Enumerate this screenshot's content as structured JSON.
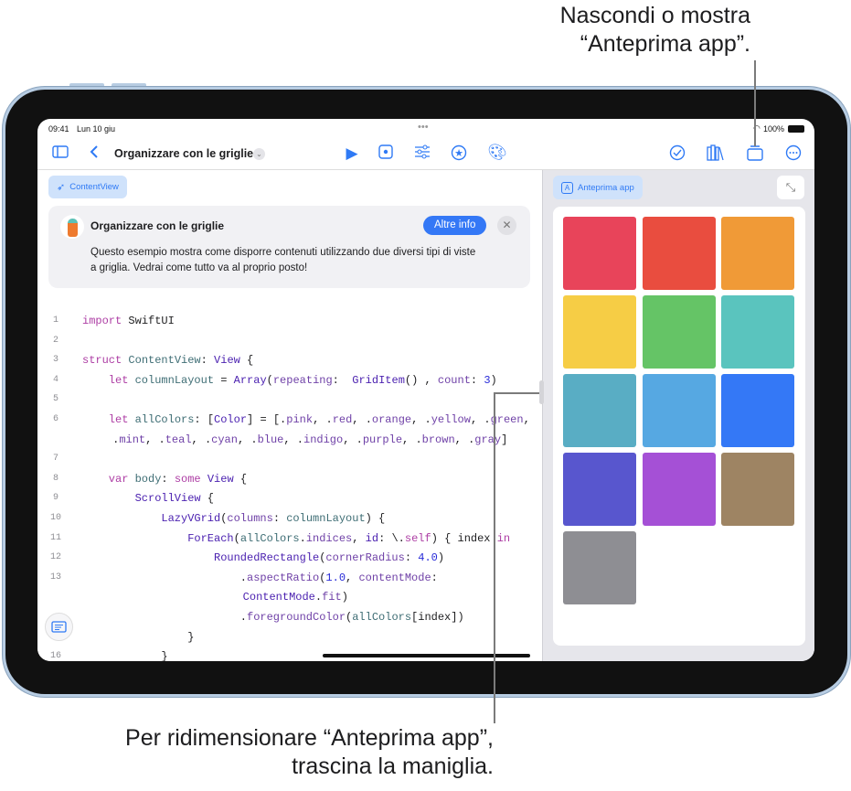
{
  "callouts": {
    "top_line1": "Nascondi o mostra",
    "top_line2": "“Anteprima app”.",
    "bottom_line1": "Per ridimensionare “Anteprima app”,",
    "bottom_line2": "trascina la maniglia."
  },
  "status": {
    "time": "09:41",
    "date": "Lun 10 giu",
    "battery": "100%"
  },
  "toolbar": {
    "title": "Organizzare con le griglie"
  },
  "file_tab": "ContentView",
  "card": {
    "title": "Organizzare con le griglie",
    "more_label": "Altre info",
    "text_line1": "Questo esempio mostra come disporre contenuti utilizzando due diversi tipi di viste",
    "text_line2": "a griglia. Vedrai come tutto va al proprio posto!"
  },
  "code": [
    {
      "n": "1",
      "indent": 0,
      "tokens": [
        [
          "import",
          "k"
        ],
        [
          " SwiftUI",
          "p"
        ]
      ]
    },
    {
      "n": "2",
      "indent": 0,
      "tokens": []
    },
    {
      "n": "3",
      "indent": 0,
      "tokens": [
        [
          "struct",
          "k"
        ],
        [
          " ContentView",
          "v"
        ],
        [
          ": ",
          "p"
        ],
        [
          "View",
          "t"
        ],
        [
          " {",
          "p"
        ]
      ]
    },
    {
      "n": "4",
      "indent": 1,
      "tokens": [
        [
          "let",
          "k"
        ],
        [
          " columnLayout",
          "v"
        ],
        [
          " = ",
          "p"
        ],
        [
          "Array",
          "t"
        ],
        [
          "(",
          "p"
        ],
        [
          "repeating",
          "m"
        ],
        [
          ":  ",
          "p"
        ],
        [
          "GridItem",
          "t"
        ],
        [
          "() , ",
          "p"
        ],
        [
          "count",
          "m"
        ],
        [
          ": ",
          "p"
        ],
        [
          "3",
          "n"
        ],
        [
          ")",
          "p"
        ]
      ]
    },
    {
      "n": "5",
      "indent": 0,
      "tokens": []
    },
    {
      "n": "6",
      "indent": 1,
      "tokens": [
        [
          "let",
          "k"
        ],
        [
          " allColors",
          "v"
        ],
        [
          ": [",
          "p"
        ],
        [
          "Color",
          "t"
        ],
        [
          "] = [.",
          "p"
        ],
        [
          "pink",
          "m"
        ],
        [
          ", .",
          "p"
        ],
        [
          "red",
          "m"
        ],
        [
          ", .",
          "p"
        ],
        [
          "orange",
          "m"
        ],
        [
          ", .",
          "p"
        ],
        [
          "yellow",
          "m"
        ],
        [
          ", .",
          "p"
        ],
        [
          "green",
          "m"
        ],
        [
          ",",
          "p"
        ]
      ]
    },
    {
      "n": "",
      "indent": 1.15,
      "tokens": [
        [
          ".",
          "p"
        ],
        [
          "mint",
          "m"
        ],
        [
          ", .",
          "p"
        ],
        [
          "teal",
          "m"
        ],
        [
          ", .",
          "p"
        ],
        [
          "cyan",
          "m"
        ],
        [
          ", .",
          "p"
        ],
        [
          "blue",
          "m"
        ],
        [
          ", .",
          "p"
        ],
        [
          "indigo",
          "m"
        ],
        [
          ", .",
          "p"
        ],
        [
          "purple",
          "m"
        ],
        [
          ", .",
          "p"
        ],
        [
          "brown",
          "m"
        ],
        [
          ", .",
          "p"
        ],
        [
          "gray",
          "m"
        ],
        [
          "]",
          "p"
        ]
      ]
    },
    {
      "n": "7",
      "indent": 0,
      "tokens": []
    },
    {
      "n": "8",
      "indent": 1,
      "tokens": [
        [
          "var",
          "k"
        ],
        [
          " body",
          "v"
        ],
        [
          ": ",
          "p"
        ],
        [
          "some",
          "k"
        ],
        [
          " View",
          "t"
        ],
        [
          " {",
          "p"
        ]
      ]
    },
    {
      "n": "9",
      "indent": 2,
      "tokens": [
        [
          "ScrollView",
          "t"
        ],
        [
          " {",
          "p"
        ]
      ]
    },
    {
      "n": "10",
      "indent": 3,
      "tokens": [
        [
          "LazyVGrid",
          "t"
        ],
        [
          "(",
          "p"
        ],
        [
          "columns",
          "m"
        ],
        [
          ": ",
          "p"
        ],
        [
          "columnLayout",
          "v"
        ],
        [
          ") {",
          "p"
        ]
      ]
    },
    {
      "n": "11",
      "indent": 4,
      "tokens": [
        [
          "ForEach",
          "t"
        ],
        [
          "(",
          "p"
        ],
        [
          "allColors",
          "v"
        ],
        [
          ".",
          "p"
        ],
        [
          "indices",
          "m"
        ],
        [
          ", ",
          "p"
        ],
        [
          "id",
          "t"
        ],
        [
          ": \\.",
          "p"
        ],
        [
          "self",
          "k"
        ],
        [
          ") { index ",
          "p"
        ],
        [
          "in",
          "k"
        ]
      ]
    },
    {
      "n": "12",
      "indent": 5,
      "tokens": [
        [
          "RoundedRectangle",
          "t"
        ],
        [
          "(",
          "p"
        ],
        [
          "cornerRadius",
          "m"
        ],
        [
          ": ",
          "p"
        ],
        [
          "4.0",
          "n"
        ],
        [
          ")",
          "p"
        ]
      ]
    },
    {
      "n": "13",
      "indent": 6,
      "tokens": [
        [
          ".",
          "p"
        ],
        [
          "aspectRatio",
          "m"
        ],
        [
          "(",
          "p"
        ],
        [
          "1.0",
          "n"
        ],
        [
          ", ",
          "p"
        ],
        [
          "contentMode",
          "m"
        ],
        [
          ":",
          "p"
        ]
      ]
    },
    {
      "n": "",
      "indent": 6.1,
      "tokens": [
        [
          "ContentMode",
          "t"
        ],
        [
          ".",
          "p"
        ],
        [
          "fit",
          "m"
        ],
        [
          ")",
          "p"
        ]
      ]
    },
    {
      "n": "",
      "indent": 6,
      "tokens": [
        [
          ".",
          "p"
        ],
        [
          "foregroundColor",
          "m"
        ],
        [
          "(",
          "p"
        ],
        [
          "allColors",
          "v"
        ],
        [
          "[index])",
          "p"
        ]
      ]
    },
    {
      "n": "",
      "indent": 4,
      "tokens": [
        [
          "}",
          "p"
        ]
      ]
    },
    {
      "n": "16",
      "indent": 3,
      "tokens": [
        [
          "}",
          "p"
        ]
      ]
    }
  ],
  "preview": {
    "tab_label": "Anteprima app",
    "colors": [
      "#e8445a",
      "#e94d3f",
      "#f09a37",
      "#f6cd45",
      "#65c466",
      "#5ac4be",
      "#59adc4",
      "#56a8e2",
      "#3478f6",
      "#5856ce",
      "#a550d6",
      "#9e8463",
      "#8e8e93"
    ]
  }
}
